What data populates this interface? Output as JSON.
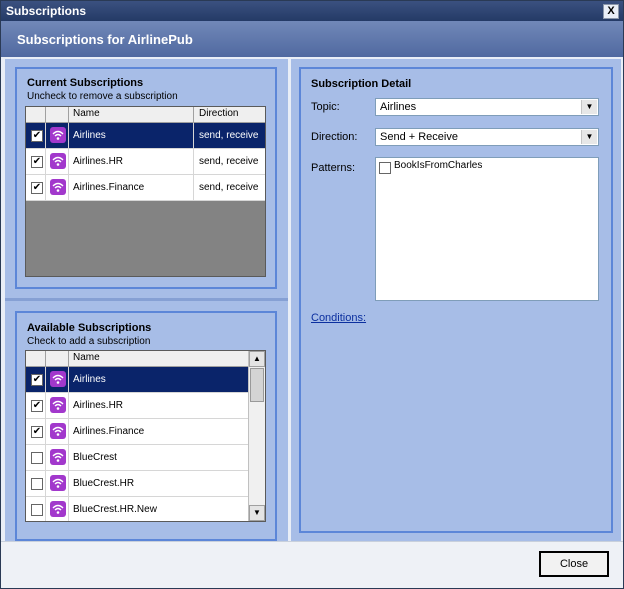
{
  "window": {
    "title": "Subscriptions",
    "close_glyph": "X"
  },
  "header": {
    "title": "Subscriptions for AirlinePub"
  },
  "current": {
    "title": "Current Subscriptions",
    "subtitle": "Uncheck to remove a subscription",
    "col_name": "Name",
    "col_direction": "Direction",
    "rows": [
      {
        "name": "Airlines",
        "direction": "send, receive",
        "checked": true,
        "selected": true
      },
      {
        "name": "Airlines.HR",
        "direction": "send, receive",
        "checked": true,
        "selected": false
      },
      {
        "name": "Airlines.Finance",
        "direction": "send, receive",
        "checked": true,
        "selected": false
      }
    ]
  },
  "available": {
    "title": "Available Subscriptions",
    "subtitle": "Check to add a subscription",
    "col_name": "Name",
    "rows": [
      {
        "name": "Airlines",
        "checked": true,
        "selected": true
      },
      {
        "name": "Airlines.HR",
        "checked": true,
        "selected": false
      },
      {
        "name": "Airlines.Finance",
        "checked": true,
        "selected": false
      },
      {
        "name": "BlueCrest",
        "checked": false,
        "selected": false
      },
      {
        "name": "BlueCrest.HR",
        "checked": false,
        "selected": false
      },
      {
        "name": "BlueCrest.HR.New",
        "checked": false,
        "selected": false
      }
    ]
  },
  "detail": {
    "title": "Subscription Detail",
    "topic_label": "Topic:",
    "topic_value": "Airlines",
    "direction_label": "Direction:",
    "direction_value": "Send + Receive",
    "patterns_label": "Patterns:",
    "patterns": [
      {
        "name": "BookIsFromCharles",
        "checked": false
      }
    ],
    "conditions_link": "Conditions:"
  },
  "footer": {
    "close_label": "Close"
  },
  "colors": {
    "accent": "#5c86d8",
    "selection": "#0a246a",
    "pane": "#a7bde7",
    "icon": "#a238cc"
  },
  "icons": {
    "subscription_icon": "wifi-signal-icon",
    "dropdown_icon": "chevron-down-icon"
  }
}
